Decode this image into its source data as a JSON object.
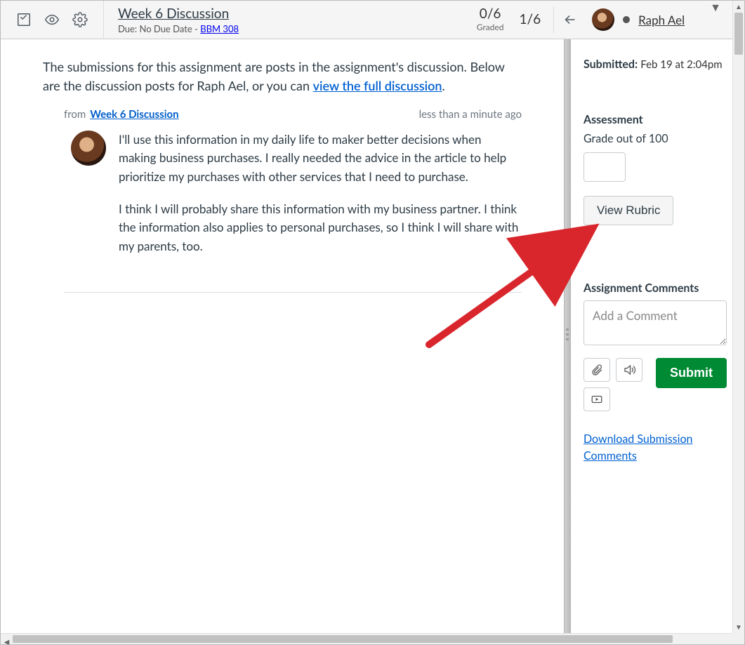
{
  "header": {
    "assignment_title": "Week 6 Discussion",
    "due_prefix": "Due: ",
    "due_text": "No Due Date",
    "course_sep": " - ",
    "course_code": "BBM 308",
    "graded_count": "0/6",
    "graded_label": "Graded",
    "position": "1/6",
    "student_name": "Raph Ael"
  },
  "content": {
    "intro_prefix": "The submissions for this assignment are posts in the assignment's discussion. Below are the discussion posts for Raph Ael, or you can ",
    "intro_link": "view the full discussion",
    "intro_suffix": ".",
    "post": {
      "from_label": "from",
      "source_link": "Week 6 Discussion",
      "timestamp": "less than a minute ago",
      "para1": "I'll use this information in my daily life to maker better decisions when making business purchases. I really needed the advice in the article to help prioritize my purchases with other services that I need to purchase.",
      "para2": "I think I will probably share this information with my business partner. I think the information also applies to personal purchases, so I think I will share with my parents, too."
    }
  },
  "sidebar": {
    "submitted_label": "Submitted:",
    "submitted_value": "Feb 19 at 2:04pm",
    "assessment_title": "Assessment",
    "grade_label": "Grade out of 100",
    "view_rubric": "View Rubric",
    "comments_title": "Assignment Comments",
    "comment_placeholder": "Add a Comment",
    "submit_label": "Submit",
    "download_link": "Download Submission Comments"
  }
}
